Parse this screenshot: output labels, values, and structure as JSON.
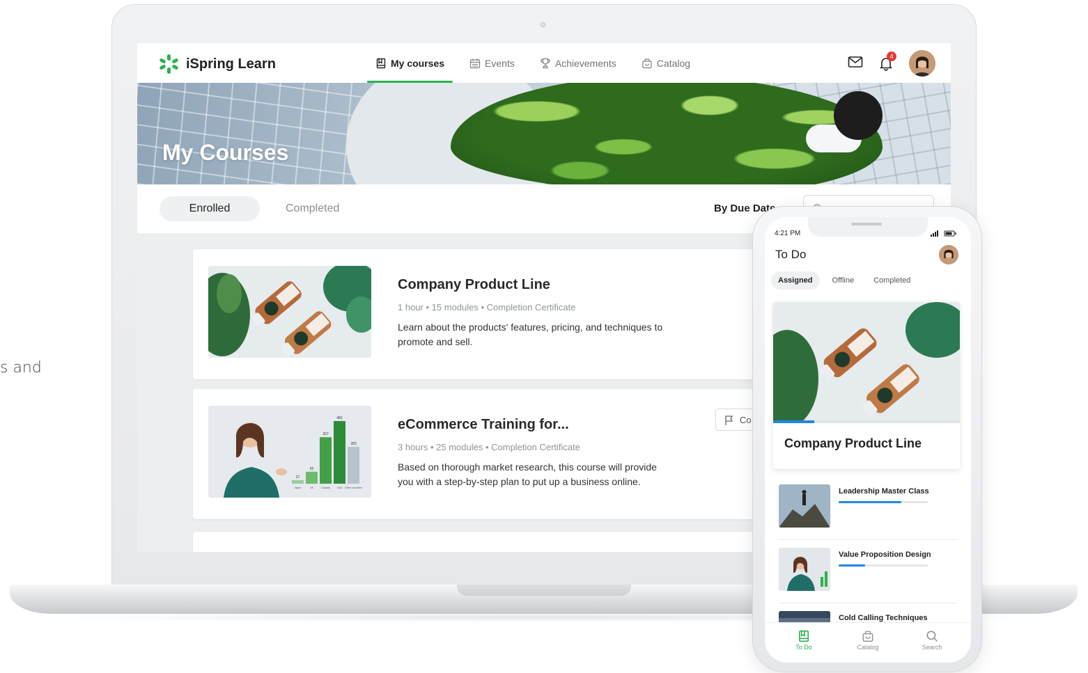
{
  "side_text": "s and",
  "app": {
    "name": "iSpring Learn"
  },
  "nav": [
    {
      "label": "My courses",
      "active": true
    },
    {
      "label": "Events",
      "active": false
    },
    {
      "label": "Achievements",
      "active": false
    },
    {
      "label": "Catalog",
      "active": false
    }
  ],
  "notifications": {
    "count": "4"
  },
  "banner": {
    "title": "My Courses"
  },
  "tabs": {
    "enrolled": "Enrolled",
    "completed": "Completed"
  },
  "sort": {
    "label": "By Due Date"
  },
  "courses": [
    {
      "title": "Company Product Line",
      "meta": "1 hour • 15 modules  •  Completion Certificate",
      "description": "Learn about the products' features, pricing, and techniques to promote and sell."
    },
    {
      "title": "eCommerce Training for...",
      "meta": "3 hours • 25 modules  •  Completion Certificate",
      "description": "Based on thorough market research, this course will provide you with a step-by-step plan to put up a business online.",
      "flag_button": "Co",
      "thumb_chart": {
        "categories": [
          "Japan",
          "UK",
          "Canada",
          "USA",
          "Other countries"
        ],
        "values": [
          27,
          92,
          357,
          481,
          283
        ]
      }
    }
  ],
  "phone": {
    "time": "4:21 PM",
    "title": "To Do",
    "tabs": [
      "Assigned",
      "Offline",
      "Completed"
    ],
    "featured": {
      "title": "Company Product Line",
      "progress": 0.22
    },
    "list": [
      {
        "title": "Leadership Master Class",
        "progress": 0.7
      },
      {
        "title": "Value Proposition Design",
        "progress": 0.3
      },
      {
        "title": "Cold Calling Techniques",
        "progress": 0
      }
    ],
    "bottom_nav": [
      {
        "label": "To Do",
        "icon": "book-icon",
        "active": true
      },
      {
        "label": "Catalog",
        "icon": "bag-icon",
        "active": false
      },
      {
        "label": "Search",
        "icon": "search-icon",
        "active": false
      }
    ]
  },
  "colors": {
    "accent": "#2bb24c",
    "progress": "#1e88e5",
    "badge": "#e53935"
  }
}
